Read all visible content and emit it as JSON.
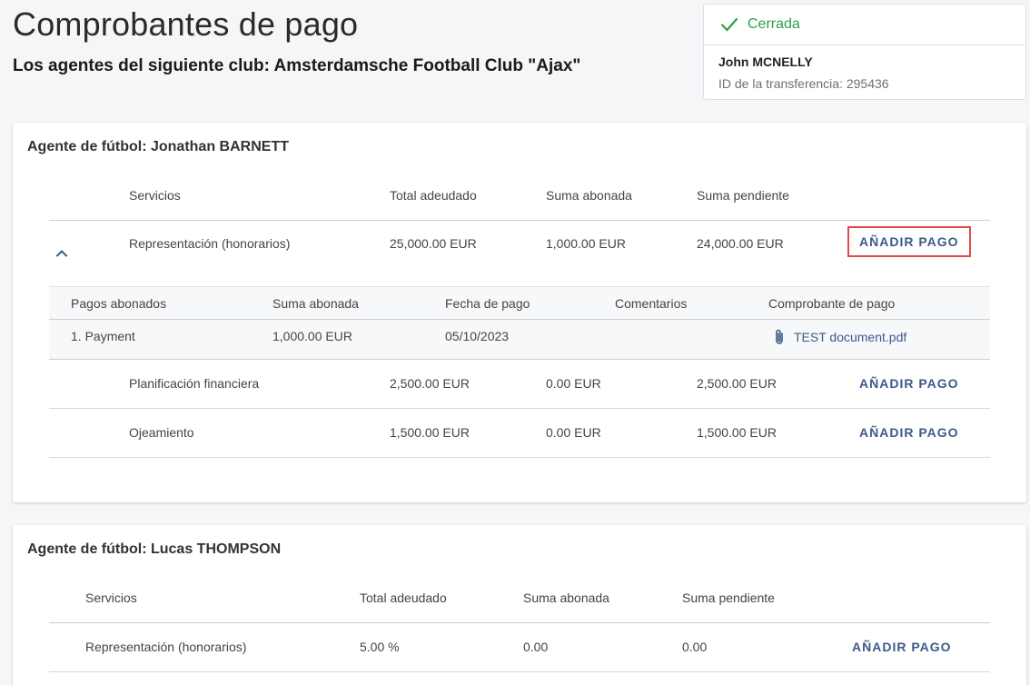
{
  "page": {
    "title": "Comprobantes de pago",
    "subtitle": "Los agentes del siguiente club: Amsterdamsche Football Club \"Ajax\""
  },
  "status": {
    "label": "Cerrada",
    "person": "John MCNELLY",
    "transfer_id": "ID de la transferencia: 295436",
    "color": "#2e9e4f"
  },
  "columns": {
    "service": "Servicios",
    "total": "Total adeudado",
    "paid": "Suma abonada",
    "pending": "Suma pendiente"
  },
  "sub_columns": {
    "payments": "Pagos abonados",
    "amount": "Suma abonada",
    "date": "Fecha de pago",
    "comments": "Comentarios",
    "receipt": "Comprobante de pago"
  },
  "add_label": "AÑADIR PAGO",
  "agents": [
    {
      "title": "Agente de fútbol: Jonathan BARNETT",
      "services": [
        {
          "name": "Representación (honorarios)",
          "total": "25,000.00 EUR",
          "paid": "1,000.00 EUR",
          "pending": "24,000.00 EUR"
        },
        {
          "name": "Planificación financiera",
          "total": "2,500.00 EUR",
          "paid": "0.00 EUR",
          "pending": "2,500.00 EUR"
        },
        {
          "name": "Ojeamiento",
          "total": "1,500.00 EUR",
          "paid": "0.00 EUR",
          "pending": "1,500.00 EUR"
        }
      ],
      "payments": [
        {
          "name": "1. Payment",
          "amount": "1,000.00 EUR",
          "date": "05/10/2023",
          "comment": "",
          "file": "TEST document.pdf"
        }
      ]
    },
    {
      "title": "Agente de fútbol: Lucas THOMPSON",
      "services": [
        {
          "name": "Representación (honorarios)",
          "total": "5.00 %",
          "paid": "0.00",
          "pending": "0.00"
        }
      ]
    }
  ],
  "icons": {
    "check": "check-icon",
    "chevron": "chevron-up-icon",
    "clip": "paperclip-icon"
  }
}
